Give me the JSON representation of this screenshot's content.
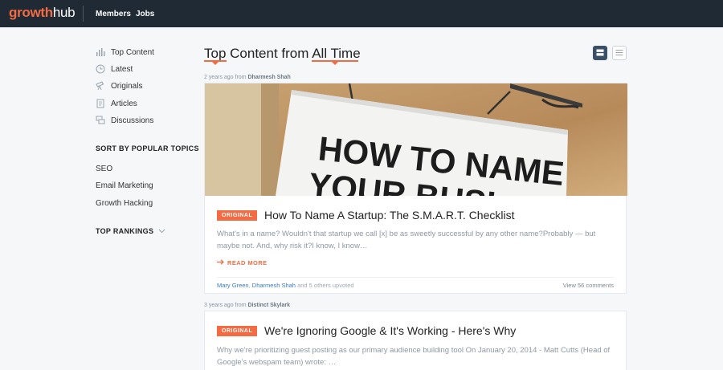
{
  "nav": {
    "logo_part1": "growth",
    "logo_part2": "hub",
    "links": [
      "Members",
      "Jobs"
    ]
  },
  "sidebar": {
    "items": [
      {
        "label": "Top Content",
        "icon": "bar-chart-icon"
      },
      {
        "label": "Latest",
        "icon": "clock-icon"
      },
      {
        "label": "Originals",
        "icon": "telescope-icon"
      },
      {
        "label": "Articles",
        "icon": "document-icon"
      },
      {
        "label": "Discussions",
        "icon": "chat-bubbles-icon"
      }
    ],
    "topics_heading": "SORT BY POPULAR TOPICS",
    "topics": [
      "SEO",
      "Email Marketing",
      "Growth Hacking"
    ],
    "rankings_heading": "TOP RANKINGS"
  },
  "main": {
    "title_part1": "Top Content from",
    "title_part2": "All Time",
    "posts": [
      {
        "meta_prefix": "2 years ago from",
        "author": "Dharmesh Shah",
        "hero_sign_line1": "HOW TO NAME",
        "hero_sign_line2": "YOUR BUSI",
        "badge": "ORIGINAL",
        "title": "How To Name A Startup: The S.M.A.R.T. Checklist",
        "excerpt": "What's in a name? Wouldn't that startup we call [x] be as sweetly successful by any other name?Probably — but maybe not. And, why risk it?I know, I know…",
        "read_more": "READ MORE",
        "upvoter1": "Mary Green",
        "upvoter2": "Dharmesh Shah",
        "upvote_suffix": "and 5 others upvoted",
        "comments": "View 56 comments"
      },
      {
        "meta_prefix": "3 years ago from",
        "author": "Distinct Skylark",
        "badge": "ORIGINAL",
        "title": "We're Ignoring Google & It's Working - Here's Why",
        "excerpt": "Why we're prioritizing guest posting as our primary audience building tool On January 20, 2014 - Matt Cutts (Head of Google's webspam team) wrote: …"
      }
    ]
  },
  "colors": {
    "accent": "#f26b43",
    "nav_bg": "#1f2a35",
    "link_blue": "#3a7bc8"
  }
}
